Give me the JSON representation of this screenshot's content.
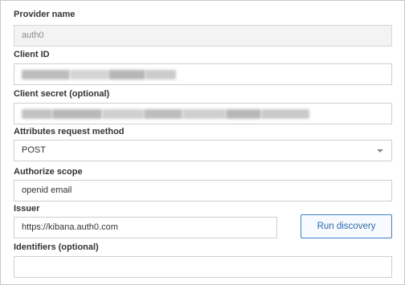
{
  "form": {
    "provider_name": {
      "label": "Provider name",
      "value": "auth0"
    },
    "client_id": {
      "label": "Client ID",
      "value_redacted": true
    },
    "client_secret": {
      "label": "Client secret (optional)",
      "value_redacted": true
    },
    "attributes_request_method": {
      "label": "Attributes request method",
      "value": "POST"
    },
    "authorize_scope": {
      "label": "Authorize scope",
      "value": "openid email"
    },
    "issuer": {
      "label": "Issuer",
      "value": "https://kibana.auth0.com"
    },
    "run_discovery_label": "Run discovery",
    "identifiers": {
      "label": "Identifiers (optional)",
      "value": ""
    }
  },
  "icons": {
    "select_caret": "chevron-down-icon"
  },
  "colors": {
    "button_accent": "#2c6aa8",
    "button_border": "#3b82c4",
    "disabled_field_bg": "#f3f3f3"
  }
}
